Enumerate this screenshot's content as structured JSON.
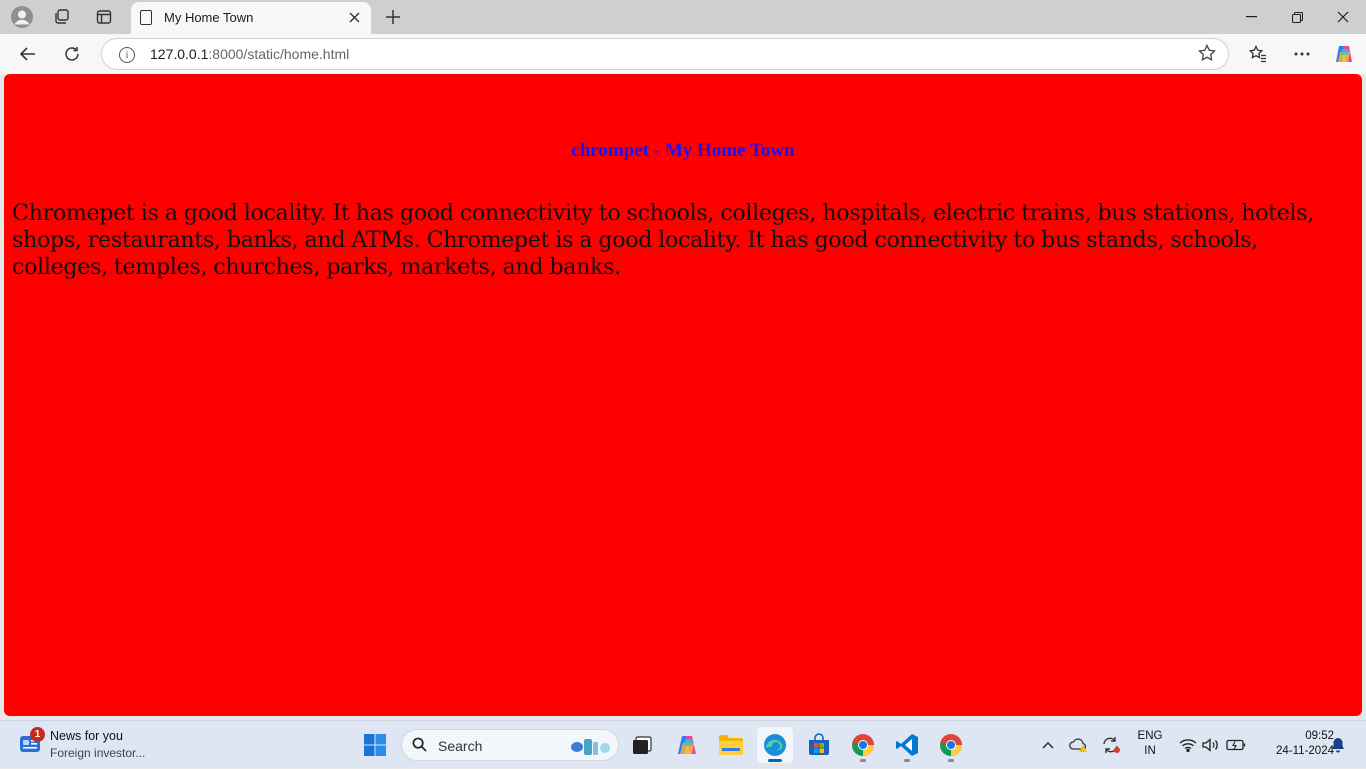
{
  "browser": {
    "tab": {
      "title": "My Home Town"
    },
    "address": {
      "host": "127.0.0.1",
      "path": ":8000/static/home.html"
    }
  },
  "page": {
    "heading": "chrompet - My Home Town",
    "paragraph": "Chromepet is a good locality. It has good connectivity to schools, colleges, hospitals, electric trains, bus stations, hotels, shops, restaurants, banks, and ATMs. Chromepet is a good locality. It has good connectivity to bus stands, schools, colleges, temples, churches, parks, markets, and banks.",
    "background_color": "#ff0000",
    "heading_color": "#1414ff"
  },
  "taskbar": {
    "news": {
      "badge": "1",
      "title": "News for you",
      "subtitle": "Foreign investor..."
    },
    "search": {
      "label": "Search"
    },
    "language": {
      "line1": "ENG",
      "line2": "IN"
    },
    "clock": {
      "time": "09:52",
      "date": "24-11-2024"
    }
  }
}
